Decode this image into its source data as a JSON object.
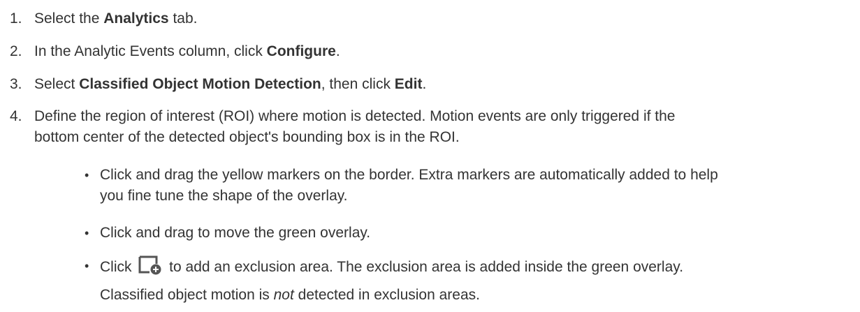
{
  "steps": [
    {
      "num": "1.",
      "pre": "Select the ",
      "bold": "Analytics",
      "post": " tab."
    },
    {
      "num": "2.",
      "pre": "In the Analytic Events column, click ",
      "bold": "Configure",
      "post": "."
    },
    {
      "num": "3.",
      "pre": "Select ",
      "bold": "Classified Object Motion Detection",
      "mid": ", then click ",
      "bold2": "Edit",
      "post": "."
    },
    {
      "num": "4.",
      "line1": "Define the region of interest (ROI) where motion is detected. Motion events are only triggered if the",
      "line2": "bottom center of the detected object's bounding box is in the ROI."
    }
  ],
  "bullets": [
    {
      "dot": "•",
      "line1": "Click and drag the yellow markers on the border. Extra markers are automatically added to help",
      "line2": "you fine tune the shape of the overlay."
    },
    {
      "dot": "•",
      "line1": "Click and drag to move the green overlay."
    },
    {
      "dot": "•",
      "pre": "Click ",
      "icon": "add-exclusion-area-icon",
      "post": " to add an exclusion area. The exclusion area is added inside the green overlay.",
      "note_pre": "Classified object motion is ",
      "note_em": "not",
      "note_post": " detected in exclusion areas."
    }
  ],
  "colors": {
    "text": "#333333",
    "icon": "#555555"
  }
}
